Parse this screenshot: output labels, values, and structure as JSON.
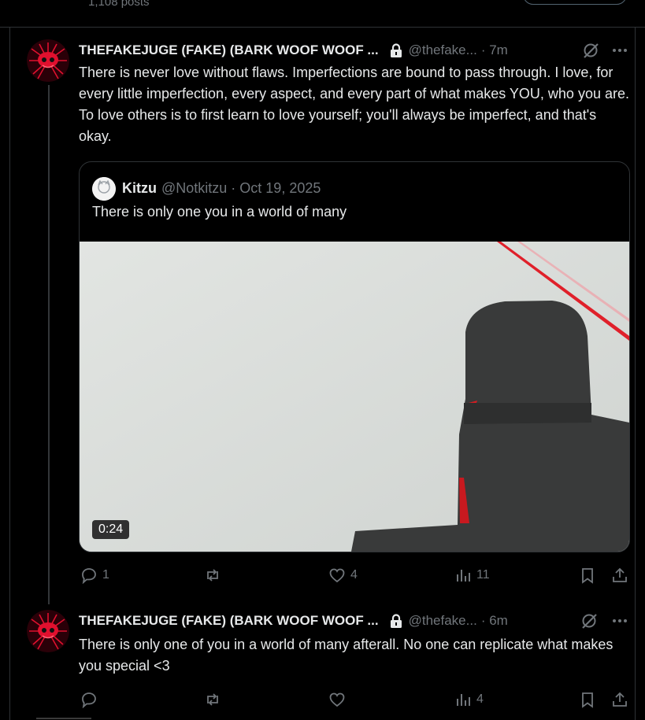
{
  "profile_header": {
    "post_count": "1,108 posts"
  },
  "posts": [
    {
      "author_name": "THEFAKEJUGE (FAKE) (BARK WOOF WOOF ...",
      "handle": "@thefake...",
      "time": "· 7m",
      "text": "There is never love without flaws. Imperfections are bound to pass through. I love, for every little imperfection, every aspect, and every part of what makes YOU, who you are. To love others is to first learn to love yourself; you'll always be imperfect, and that's okay.",
      "quote": {
        "author_name": "Kitzu",
        "meta": "@Notkitzu · Oct 19, 2025",
        "text": "There is only one you in a world of many",
        "video_duration": "0:24"
      },
      "actions": {
        "replies": "1",
        "reposts": "",
        "likes": "4",
        "views": "11"
      }
    },
    {
      "author_name": "THEFAKEJUGE (FAKE) (BARK WOOF WOOF ...",
      "handle": "@thefake...",
      "time": "· 6m",
      "text": "There is only one of you in a world of many afterall. No one can replicate what makes you special <3",
      "actions": {
        "replies": "",
        "reposts": "",
        "likes": "",
        "views": "4"
      }
    }
  ],
  "colors": {
    "background": "#000000",
    "text": "#e7e9ea",
    "muted": "#71767b",
    "border": "#2f3336",
    "accent_red": "#d8102a"
  }
}
